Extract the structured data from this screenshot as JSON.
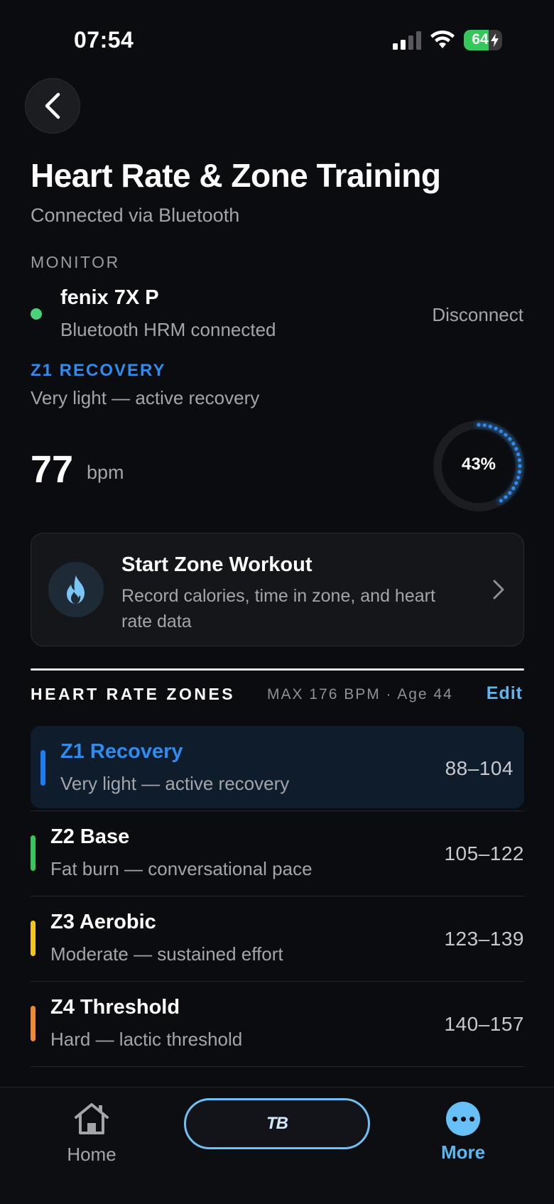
{
  "status_bar": {
    "time": "07:54",
    "battery": "64",
    "battery_level": 0.64
  },
  "header": {
    "title": "Heart Rate & Zone Training",
    "subtitle": "Connected via Bluetooth"
  },
  "monitor": {
    "section_label": "MONITOR",
    "device_name": "fenix 7X P",
    "device_status": "Bluetooth HRM connected",
    "disconnect_label": "Disconnect",
    "status_color": "#4ad27a"
  },
  "current": {
    "zone_label": "Z1 RECOVERY",
    "zone_desc": "Very light — active recovery",
    "bpm": "77",
    "bpm_unit": "bpm",
    "percent_label": "43%",
    "percent": 0.43,
    "accent": "#2e8bf0"
  },
  "workout": {
    "title": "Start Zone Workout",
    "subtitle": "Record calories, time in zone, and heart rate data",
    "icon": "flame-icon"
  },
  "zones": {
    "heading": "HEART RATE ZONES",
    "max_info": "MAX 176 BPM · Age 44",
    "edit_label": "Edit",
    "items": [
      {
        "name": "Z1 Recovery",
        "desc": "Very light — active recovery",
        "range": "88–104",
        "color": "#1a7ff0",
        "active": true
      },
      {
        "name": "Z2 Base",
        "desc": "Fat burn — conversational pace",
        "range": "105–122",
        "color": "#34c759",
        "active": false
      },
      {
        "name": "Z3 Aerobic",
        "desc": "Moderate — sustained effort",
        "range": "123–139",
        "color": "#f5c518",
        "active": false
      },
      {
        "name": "Z4 Threshold",
        "desc": "Hard — lactic threshold",
        "range": "140–157",
        "color": "#f08a30",
        "active": false
      }
    ]
  },
  "tabbar": {
    "home_label": "Home",
    "center_label": "TB",
    "more_label": "More"
  }
}
